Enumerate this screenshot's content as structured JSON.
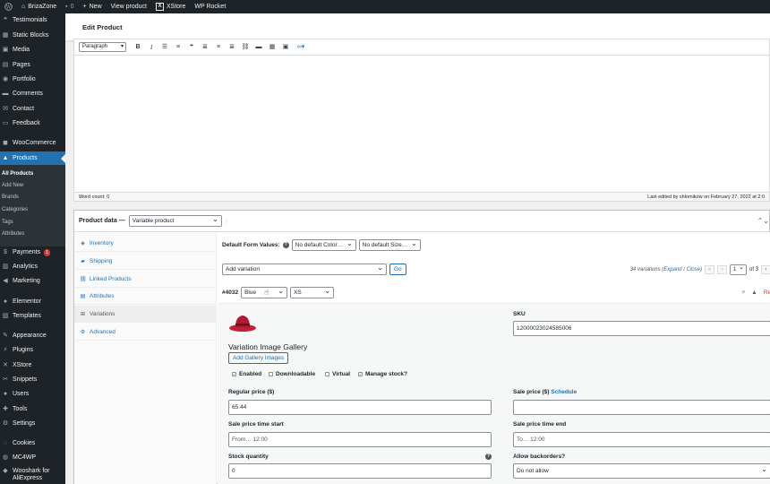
{
  "admin_bar": {
    "site_name": "BrizaZone",
    "comments_count": "0",
    "new_label": "New",
    "view_product_label": "View product",
    "xstore_label": "XStore",
    "wp_rocket_label": "WP Rocket"
  },
  "sidebar": {
    "items": [
      {
        "label": "Testimonials",
        "icon": "testimonial-icon"
      },
      {
        "label": "Static Blocks",
        "icon": "blocks-icon"
      },
      {
        "label": "Media",
        "icon": "media-icon"
      },
      {
        "label": "Pages",
        "icon": "page-icon"
      },
      {
        "label": "Portfolio",
        "icon": "portfolio-icon"
      },
      {
        "label": "Comments",
        "icon": "comment-icon"
      },
      {
        "label": "Contact",
        "icon": "mail-icon"
      },
      {
        "label": "Feedback",
        "icon": "feedback-icon"
      },
      {
        "label": "WooCommerce",
        "icon": "woo-icon"
      },
      {
        "label": "Products",
        "icon": "products-icon"
      },
      {
        "label": "Payments",
        "icon": "payments-icon",
        "badge": "1"
      },
      {
        "label": "Analytics",
        "icon": "analytics-icon"
      },
      {
        "label": "Marketing",
        "icon": "marketing-icon"
      },
      {
        "label": "Elementor",
        "icon": "elementor-icon"
      },
      {
        "label": "Templates",
        "icon": "templates-icon"
      },
      {
        "label": "Appearance",
        "icon": "appearance-icon"
      },
      {
        "label": "Plugins",
        "icon": "plugins-icon"
      },
      {
        "label": "XStore",
        "icon": "xstore-icon"
      },
      {
        "label": "Snippets",
        "icon": "snippets-icon"
      },
      {
        "label": "Users",
        "icon": "users-icon"
      },
      {
        "label": "Tools",
        "icon": "tools-icon"
      },
      {
        "label": "Settings",
        "icon": "settings-icon"
      },
      {
        "label": "Cookies",
        "icon": "cookies-icon"
      },
      {
        "label": "MC4WP",
        "icon": "mc4wp-icon"
      },
      {
        "label": "Wooshark for",
        "label2": "AliExpress",
        "icon": "wooshark-icon"
      }
    ],
    "products_submenu": [
      "All Products",
      "Add New",
      "Brands",
      "Categories",
      "Tags",
      "Attributes"
    ]
  },
  "page": {
    "title": "Edit Product"
  },
  "editor": {
    "format_select": "Paragraph",
    "word_count": "Word count: 0",
    "last_edited": "Last edited by shlomikow on February 27, 2022 at 2:0"
  },
  "product_data": {
    "label": "Product data —",
    "type_value": "Variable product",
    "tabs": [
      {
        "label": "Inventory",
        "icon": "inventory-icon"
      },
      {
        "label": "Shipping",
        "icon": "shipping-icon"
      },
      {
        "label": "Linked Products",
        "icon": "link-icon"
      },
      {
        "label": "Attributes",
        "icon": "attributes-icon"
      },
      {
        "label": "Variations",
        "icon": "variations-icon"
      },
      {
        "label": "Advanced",
        "icon": "advanced-icon"
      }
    ],
    "default_form_values_label": "Default Form Values:",
    "default_color": "No default Color…",
    "default_size": "No default Size…",
    "add_variation": "Add variation",
    "go_label": "Go",
    "variations_count": "34 variations (",
    "expand_label": "Expand",
    "close_label": "Close",
    "page_current": "1",
    "page_total": "of 3",
    "variation": {
      "id": "#4032",
      "color": "Blue",
      "size": "XS",
      "remove_label": "Re",
      "sku_label": "SKU",
      "sku_value": "12000023024585006",
      "gallery_title": "Variation Image Gallery",
      "add_gallery_label": "Add Gallery Images",
      "enabled_label": "Enabled",
      "downloadable_label": "Downloadable",
      "virtual_label": "Virtual",
      "manage_stock_label": "Manage stock?",
      "regular_price_label": "Regular price ($)",
      "regular_price_value": "65.44",
      "sale_price_label": "Sale price ($)",
      "schedule_label": "Schedule",
      "sale_start_label": "Sale price time start",
      "sale_start_placeholder": "From… 12:00",
      "sale_end_label": "Sale price time end",
      "sale_end_placeholder": "To… 12:00",
      "stock_qty_label": "Stock quantity",
      "stock_qty_value": "0",
      "backorders_label": "Allow backorders?",
      "backorders_value": "Do not allow"
    }
  },
  "colors": {
    "sidebar_bg": "#1d2327",
    "accent": "#2271b1",
    "hat_red": "#c0203a"
  }
}
